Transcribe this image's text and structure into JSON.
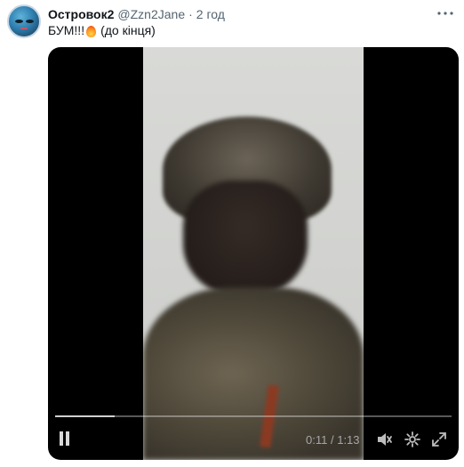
{
  "tweet": {
    "display_name": "Островок2",
    "handle": "@Zzn2Jane",
    "separator": "·",
    "time": "2 год",
    "text_before": "БУМ!!!",
    "emoji": "fire",
    "text_after": "(до кінця)",
    "more_icon": "more-icon"
  },
  "video": {
    "current_time": "0:11",
    "time_separator": "/",
    "duration": "1:13",
    "progress_fraction": 0.151,
    "icons": [
      "pause-icon",
      "volume-icon",
      "settings-icon",
      "fullscreen-icon"
    ]
  }
}
